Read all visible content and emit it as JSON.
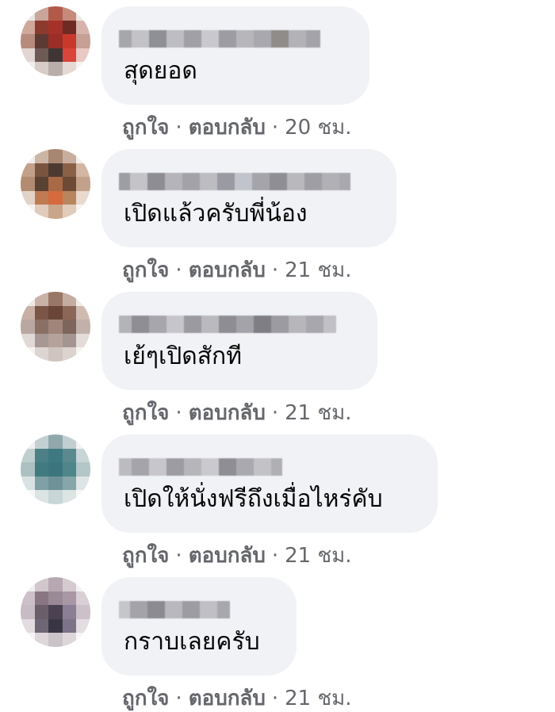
{
  "labels": {
    "like": "ถูกใจ",
    "reply": "ตอบกลับ",
    "separator": "·"
  },
  "comments": [
    {
      "text": "สุดยอด",
      "time": "20 ชม."
    },
    {
      "text": "เปิดแล้วครับพี่น้อง",
      "time": "21 ชม."
    },
    {
      "text": "เย้ๆเปิดสักที",
      "time": "21 ชม."
    },
    {
      "text": "เปิดให้นั่งฟรีถึงเมื่อไหร่คับ",
      "time": "21 ชม."
    },
    {
      "text": "กราบเลยครับ",
      "time": "21 ชม."
    }
  ],
  "colors": {
    "bubble": "#f0f2f5",
    "meta_text": "#65676b",
    "body_text": "#050505"
  }
}
